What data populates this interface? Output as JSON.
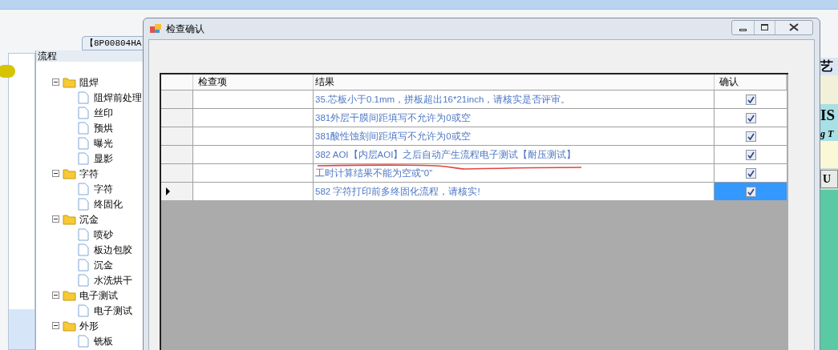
{
  "background": {
    "tab": "【8P00804HA",
    "tree_header": "流程",
    "tree": [
      {
        "label": "阻焊",
        "expanded": true,
        "children": [
          {
            "label": "阻焊前处理"
          },
          {
            "label": "丝印"
          },
          {
            "label": "预烘"
          },
          {
            "label": "曝光"
          },
          {
            "label": "显影"
          }
        ]
      },
      {
        "label": "字符",
        "expanded": true,
        "children": [
          {
            "label": "字符"
          },
          {
            "label": "终固化"
          }
        ]
      },
      {
        "label": "沉金",
        "expanded": true,
        "children": [
          {
            "label": "喷砂"
          },
          {
            "label": "板边包胶"
          },
          {
            "label": "沉金"
          },
          {
            "label": "水洗烘干"
          }
        ]
      },
      {
        "label": "电子测试",
        "expanded": true,
        "children": [
          {
            "label": "电子测试"
          }
        ]
      },
      {
        "label": "外形",
        "expanded": true,
        "children": [
          {
            "label": "铣板"
          }
        ]
      }
    ],
    "right_panel": {
      "heading_fragment": "艺",
      "title_fragment": "IS",
      "subtitle_fragment": "g T",
      "button_fragment": "U"
    }
  },
  "dialog": {
    "title": "检查确认",
    "columns": [
      "检查项",
      "结果",
      "确认"
    ],
    "rows": [
      {
        "result": "35.芯板小于0.1mm，拼板超出16*21inch，请核实是否评审。",
        "checked": true,
        "selected": false
      },
      {
        "result": "381外层干膜间距填写不允许为0或空",
        "checked": true,
        "selected": false
      },
      {
        "result": "381酸性蚀刻间距填写不允许为0或空",
        "checked": true,
        "selected": false
      },
      {
        "result": "382 AOI【内层AOI】之后自动产生流程电子测试【耐压测试】",
        "checked": true,
        "selected": false
      },
      {
        "result": "工时计算结果不能为空或“0”",
        "checked": true,
        "selected": false
      },
      {
        "result": "582 字符打印前多终固化流程，请核实!",
        "checked": true,
        "selected": true
      }
    ]
  }
}
